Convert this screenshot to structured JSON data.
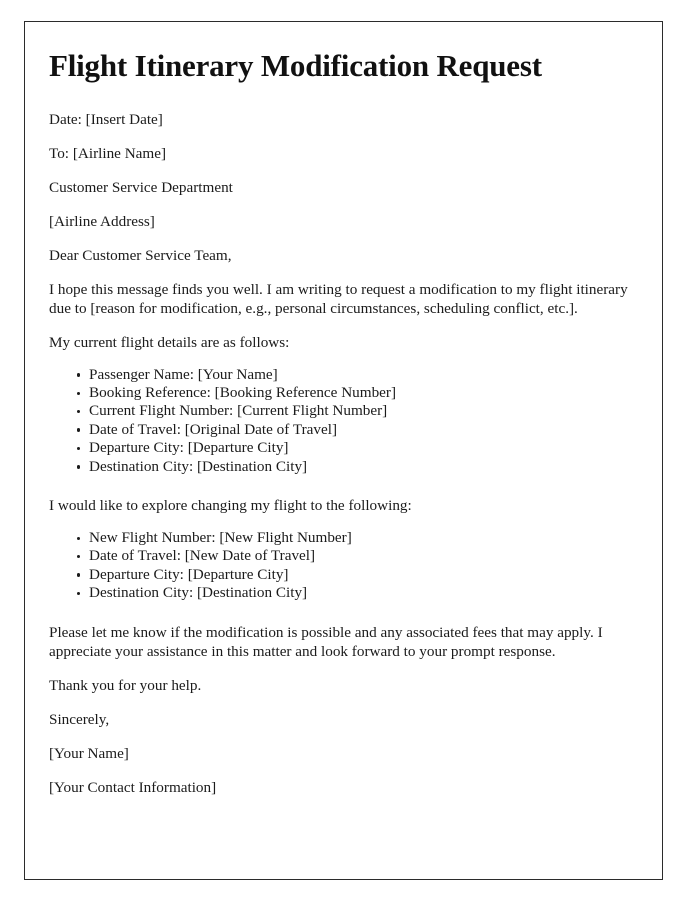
{
  "document": {
    "title": "Flight Itinerary Modification Request",
    "date_line": "Date: [Insert Date]",
    "to_line": "To: [Airline Name]",
    "department_line": "Customer Service Department",
    "address_line": "[Airline Address]",
    "salutation": "Dear Customer Service Team,",
    "intro_paragraph": "I hope this message finds you well. I am writing to request a modification to my flight itinerary due to [reason for modification, e.g., personal circumstances, scheduling conflict, etc.].",
    "current_details_heading": "My current flight details are as follows:",
    "current_details": [
      "Passenger Name: [Your Name]",
      "Booking Reference: [Booking Reference Number]",
      "Current Flight Number: [Current Flight Number]",
      "Date of Travel: [Original Date of Travel]",
      "Departure City: [Departure City]",
      "Destination City: [Destination City]"
    ],
    "requested_changes_heading": "I would like to explore changing my flight to the following:",
    "requested_changes": [
      "New Flight Number: [New Flight Number]",
      "Date of Travel: [New Date of Travel]",
      "Departure City: [Departure City]",
      "Destination City: [Destination City]"
    ],
    "closing_paragraph": "Please let me know if the modification is possible and any associated fees that may apply. I appreciate your assistance in this matter and look forward to your prompt response.",
    "thanks_line": "Thank you for your help.",
    "sign_off": "Sincerely,",
    "signature_name": "[Your Name]",
    "signature_contact": "[Your Contact Information]"
  },
  "colors": {
    "page_background": "#ffffff",
    "border": "#2b2b2b",
    "text": "#1b1b1b",
    "title_text": "#111111"
  }
}
